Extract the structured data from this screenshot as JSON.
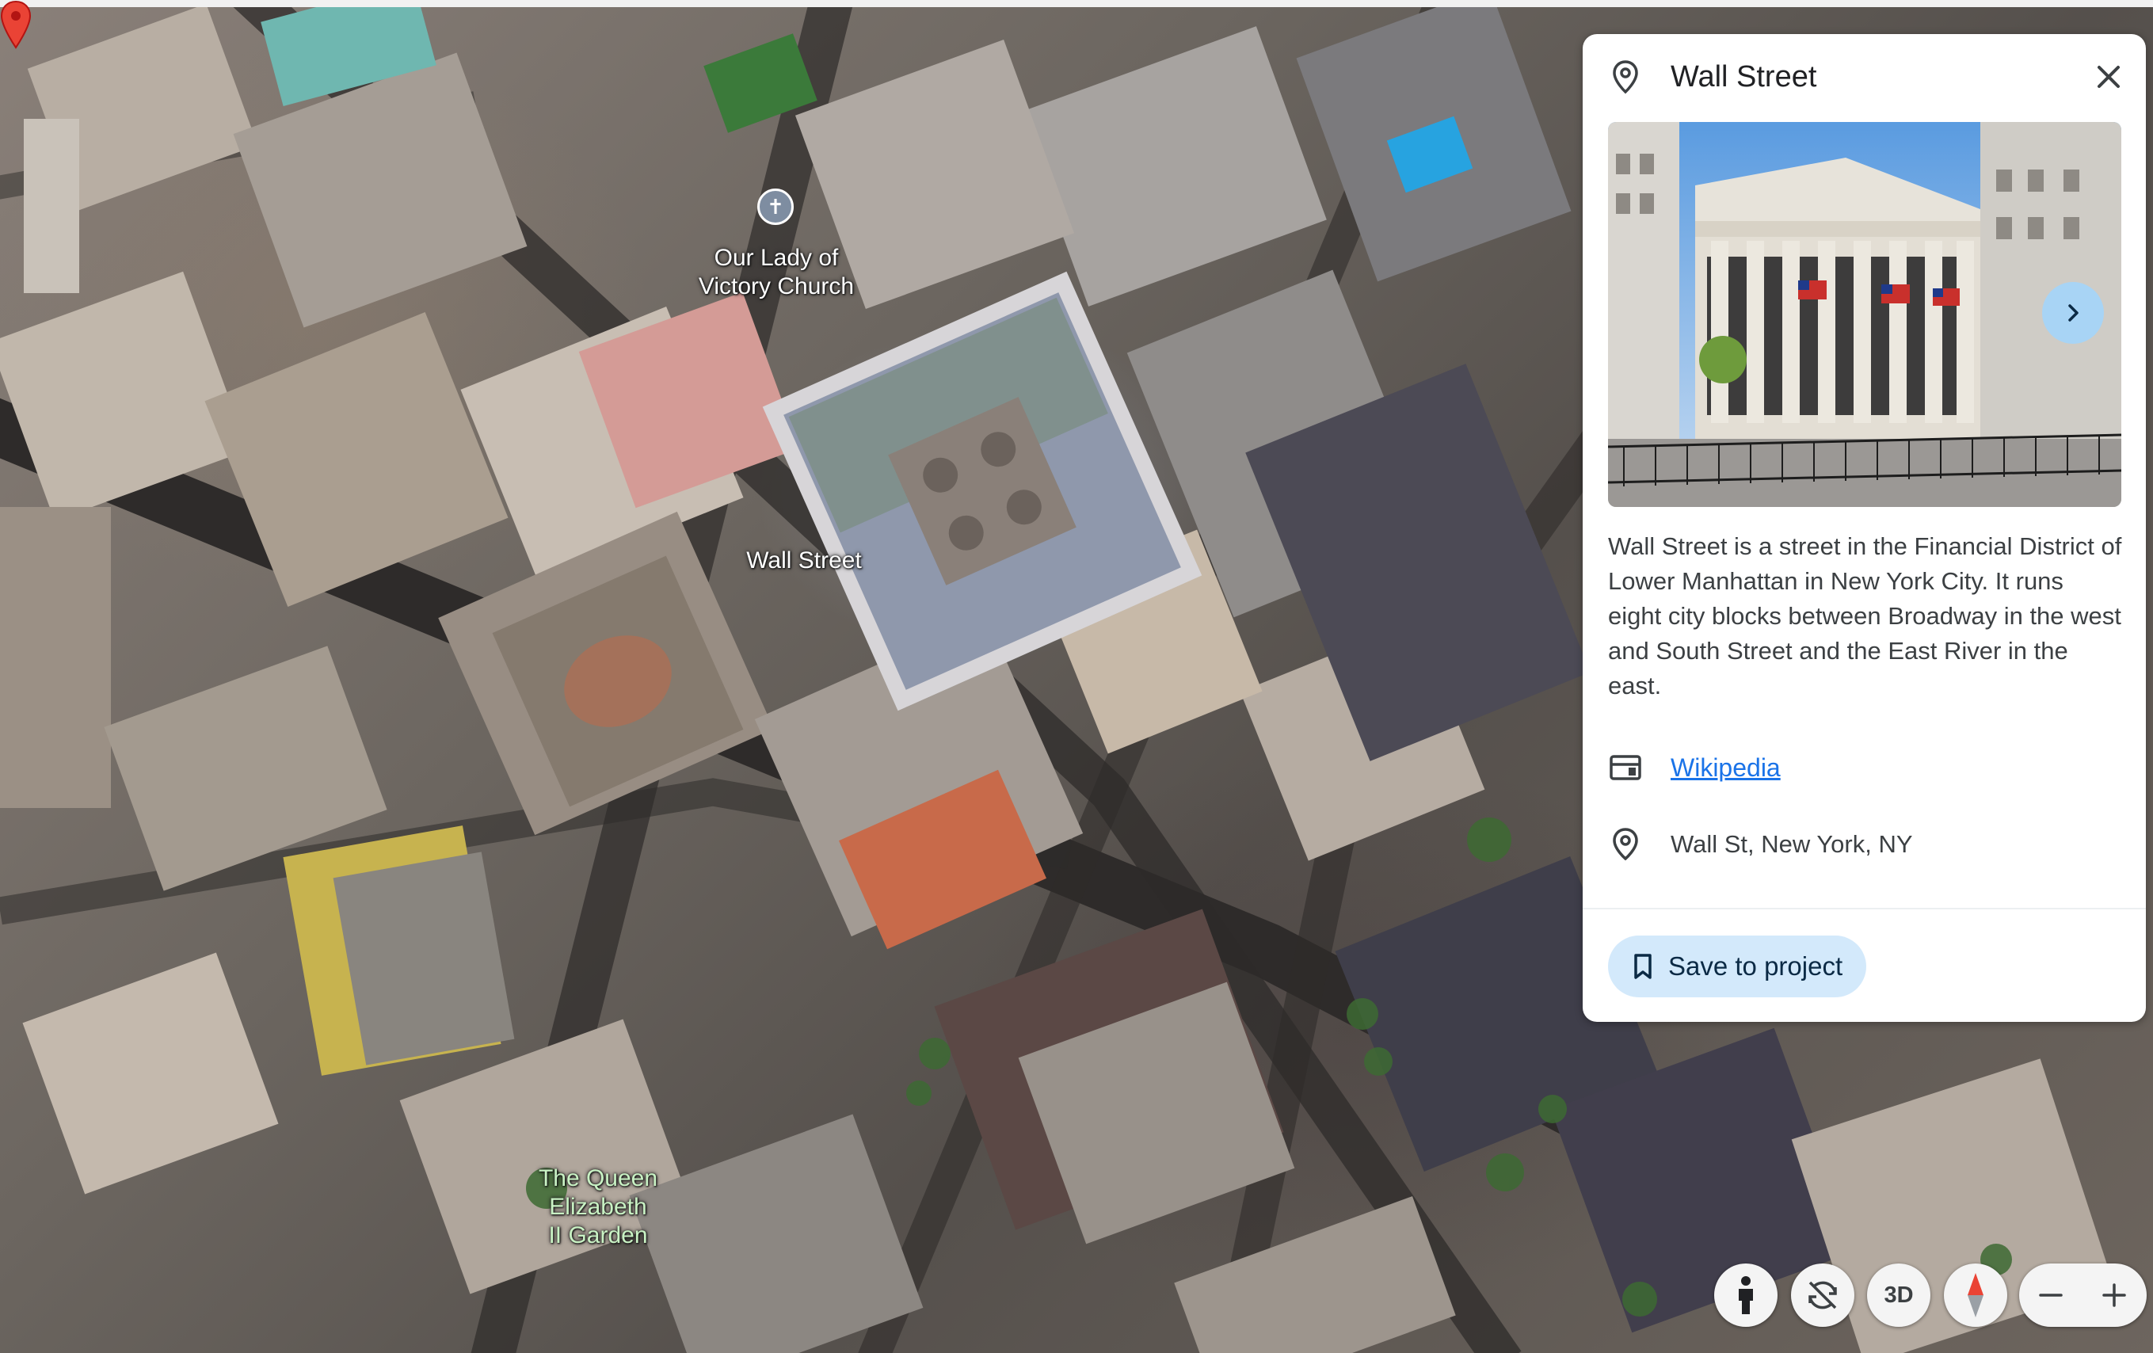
{
  "map": {
    "labels": {
      "church": "Our Lady of\nVictory Church",
      "street": "Wall Street",
      "garden": "The Queen\nElizabeth\nII Garden"
    },
    "icons": {
      "church_poi": "cross-icon",
      "selected_pin": "red-map-pin-icon"
    }
  },
  "panel": {
    "title": "Wall Street",
    "description": "Wall Street is a street in the Financial District of Lower Manhattan in New York City. It runs eight city blocks between Broadway in the west and South Street and the East River in the east.",
    "wikipedia_label": "Wikipedia",
    "address": "Wall St, New York, NY",
    "save_label": "Save to project"
  },
  "controls": {
    "view_3d_label": "3D"
  },
  "colors": {
    "accent": "#1a73e8",
    "save_bg": "#d3e9fb",
    "next_btn_bg": "#a8d4f5",
    "pin_red": "#ea4335"
  }
}
